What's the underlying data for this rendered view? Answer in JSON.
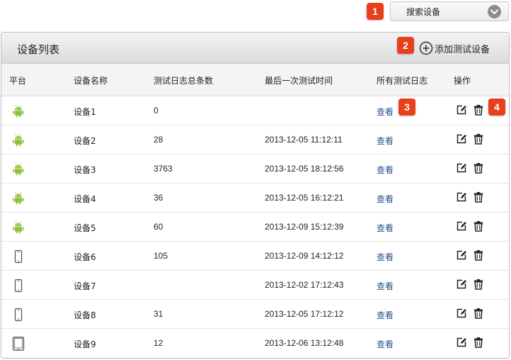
{
  "search": {
    "label": "搜索设备"
  },
  "badges": [
    "1",
    "2",
    "3",
    "4"
  ],
  "panel": {
    "title": "设备列表",
    "add_label": "添加测试设备"
  },
  "columns": {
    "platform": "平台",
    "name": "设备名称",
    "count": "测试日志总条数",
    "last_time": "最后一次测试时间",
    "logs": "所有测试日志",
    "ops": "操作"
  },
  "colors": {
    "android": "#8fc23c",
    "link": "#2a4f8c",
    "badge": "#e8401c"
  },
  "rows": [
    {
      "platform": "android-icon",
      "name": "设备1",
      "count": "0",
      "last_time": "",
      "view": "查看"
    },
    {
      "platform": "android-icon",
      "name": "设备2",
      "count": "28",
      "last_time": "2013-12-05 11:12:11",
      "view": "查看"
    },
    {
      "platform": "android-icon",
      "name": "设备3",
      "count": "3763",
      "last_time": "2013-12-05 18:12:56",
      "view": "查看"
    },
    {
      "platform": "android-icon",
      "name": "设备4",
      "count": "36",
      "last_time": "2013-12-05 16:12:21",
      "view": "查看"
    },
    {
      "platform": "android-icon",
      "name": "设备5",
      "count": "60",
      "last_time": "2013-12-09 15:12:39",
      "view": "查看"
    },
    {
      "platform": "phone-icon",
      "name": "设备6",
      "count": "105",
      "last_time": "2013-12-09 14:12:12",
      "view": "查看"
    },
    {
      "platform": "phone-icon",
      "name": "设备7",
      "count": "",
      "last_time": "2013-12-02 17:12:43",
      "view": "查看"
    },
    {
      "platform": "phone-icon",
      "name": "设备8",
      "count": "31",
      "last_time": "2013-12-05 17:12:12",
      "view": "查看"
    },
    {
      "platform": "tablet-icon",
      "name": "设备9",
      "count": "12",
      "last_time": "2013-12-06 13:12:48",
      "view": "查看"
    }
  ]
}
